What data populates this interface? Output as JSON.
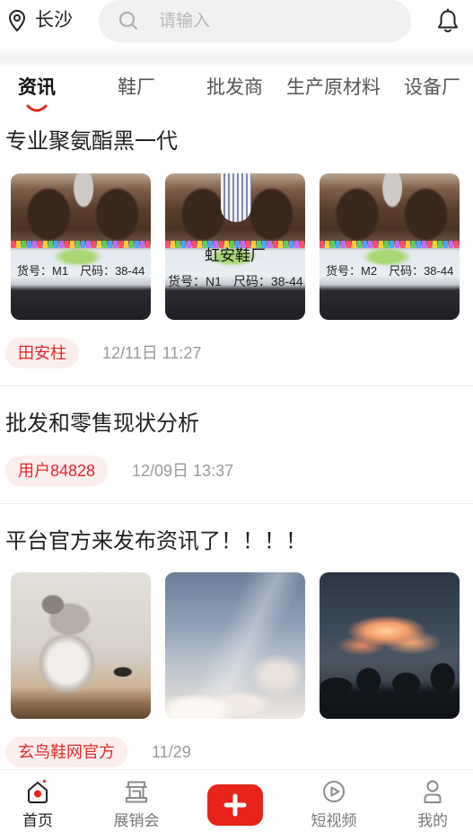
{
  "header": {
    "location_icon": "location-pin-icon",
    "location": "长沙",
    "search_icon": "search-icon",
    "search_placeholder": "请输入",
    "notification_icon": "bell-icon"
  },
  "tabs": [
    {
      "label": "资讯",
      "active": true
    },
    {
      "label": "鞋厂",
      "active": false
    },
    {
      "label": "批发商",
      "active": false
    },
    {
      "label": "生产原材料",
      "active": false
    },
    {
      "label": "设备厂",
      "active": false
    }
  ],
  "feed": [
    {
      "title": "专业聚氨酯黑一代",
      "images": [
        {
          "code": "货号：M1",
          "size": "尺码：38-44"
        },
        {
          "brand": "虹安鞋厂",
          "code": "货号：N1",
          "size": "尺码：38-44"
        },
        {
          "code": "货号：M2",
          "size": "尺码：38-44"
        }
      ],
      "author": "田安柱",
      "time": "12/11日 11:27"
    },
    {
      "title": "批发和零售现状分析",
      "author": "用户84828",
      "time": "12/09日 13:37"
    },
    {
      "title": "平台官方来发布资讯了！！！！",
      "author": "玄鸟鞋网官方",
      "time": "11/29"
    }
  ],
  "bottom_nav": [
    {
      "label": "首页",
      "icon": "home-icon",
      "active": true
    },
    {
      "label": "展销会",
      "icon": "exhibition-icon",
      "active": false
    },
    {
      "icon": "plus-icon",
      "active": false
    },
    {
      "label": "短视频",
      "icon": "video-icon",
      "active": false
    },
    {
      "label": "我的",
      "icon": "user-icon",
      "active": false
    }
  ],
  "colors": {
    "accent": "#e8231a",
    "badge_bg": "#fdeeee",
    "badge_text": "#e02a2a",
    "title_text": "#222222",
    "muted_text": "#999999",
    "nav_inactive": "#777777"
  }
}
